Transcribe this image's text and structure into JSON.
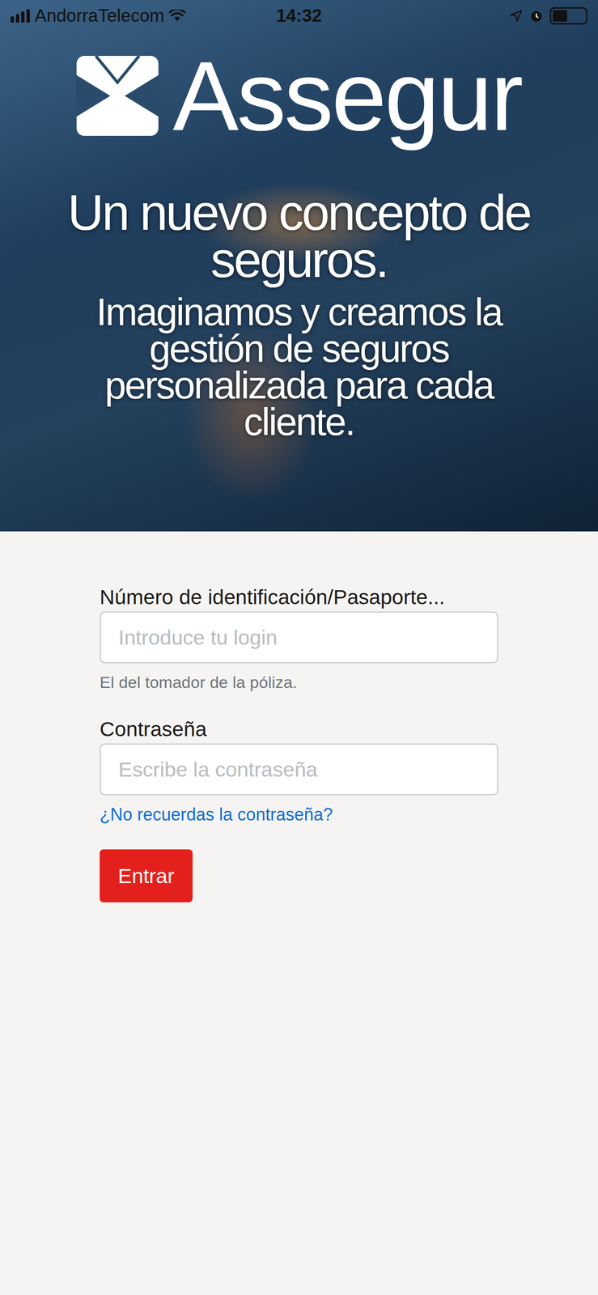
{
  "status_bar": {
    "carrier": "AndorraTelecom",
    "time": "14:32",
    "signal_level": 1,
    "battery_level": 0.45
  },
  "hero": {
    "brand": "Assegur",
    "headline": "Un nuevo concepto de seguros.",
    "tagline": "Imaginamos y creamos la gestión de seguros personalizada para cada cliente."
  },
  "form": {
    "fields": [
      {
        "kind": "text",
        "label": "Número de identificación/Pasaporte...",
        "placeholder": "Introduce tu login",
        "help": "El del tomador de la póliza.",
        "link": ""
      },
      {
        "kind": "password",
        "label": "Contraseña",
        "placeholder": "Escribe la contraseña",
        "help": "",
        "link": "¿No recuerdas la contraseña?"
      }
    ],
    "submit": "Entrar"
  }
}
